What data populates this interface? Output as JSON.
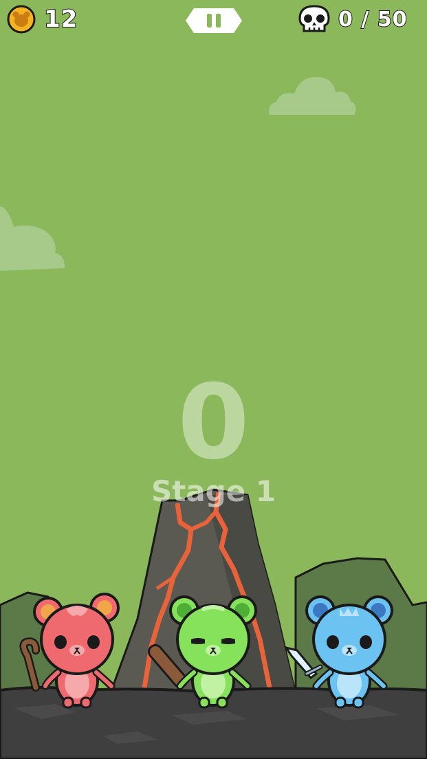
{
  "hud": {
    "coin_count": "12",
    "kill_count": "0",
    "kill_separator": " / ",
    "kill_target": "50"
  },
  "center": {
    "score": "0",
    "stage_label": "Stage 1"
  },
  "icons": {
    "coin": "bear-coin-icon",
    "pause": "pause-icon",
    "skull": "skull-icon"
  },
  "colors": {
    "sky": "#8cb85c",
    "ground": "#3f3f3f",
    "volcano": "#5a5a52",
    "lava": "#e8623a",
    "red_bear": "#ef6a6e",
    "green_bear": "#86e25a",
    "blue_bear": "#6cc3f2",
    "coin": "#f5b324"
  },
  "characters": [
    {
      "name": "red-bear",
      "weapon": "wooden-staff"
    },
    {
      "name": "green-bear",
      "weapon": "wooden-club"
    },
    {
      "name": "blue-bear",
      "weapon": "sword"
    }
  ]
}
